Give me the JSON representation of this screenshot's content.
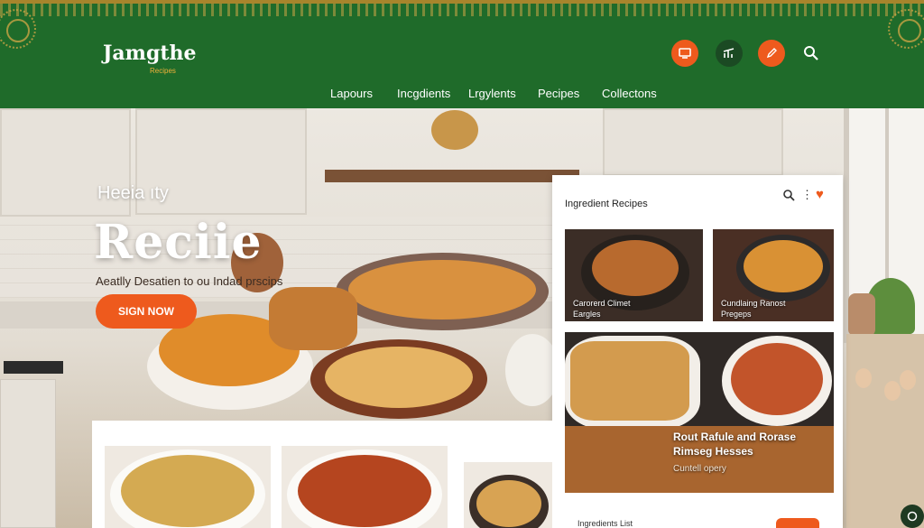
{
  "brand": {
    "name": "Jamgthe",
    "tagline": "Recipes"
  },
  "header": {
    "icons": [
      "card-icon",
      "chart-icon",
      "pencil-icon",
      "search-icon"
    ]
  },
  "nav": [
    "Lapours",
    "Incgdients",
    "Lrgylents",
    "Pecipes",
    "Collectons"
  ],
  "hero": {
    "kicker": "Heeia ıty",
    "title": "Reciie",
    "description": "Aeatlly Desatien to ou Indad prscips",
    "cta": "SIGN NOW"
  },
  "panel": {
    "title": "Ingredient Recipes",
    "cards": [
      {
        "label": "Carorerd Climet\nEargles"
      },
      {
        "label": "Cundlaing Ranost\nPregeps"
      },
      {
        "label": "Rout Rafule and Rorase\nRimseg Hesses"
      },
      {
        "label": "Cuntell opery"
      }
    ],
    "list_label": "Ingredients List"
  },
  "colors": {
    "header_green": "#1f6b2a",
    "accent_orange": "#ee5a1d",
    "gold": "#c9a445"
  }
}
